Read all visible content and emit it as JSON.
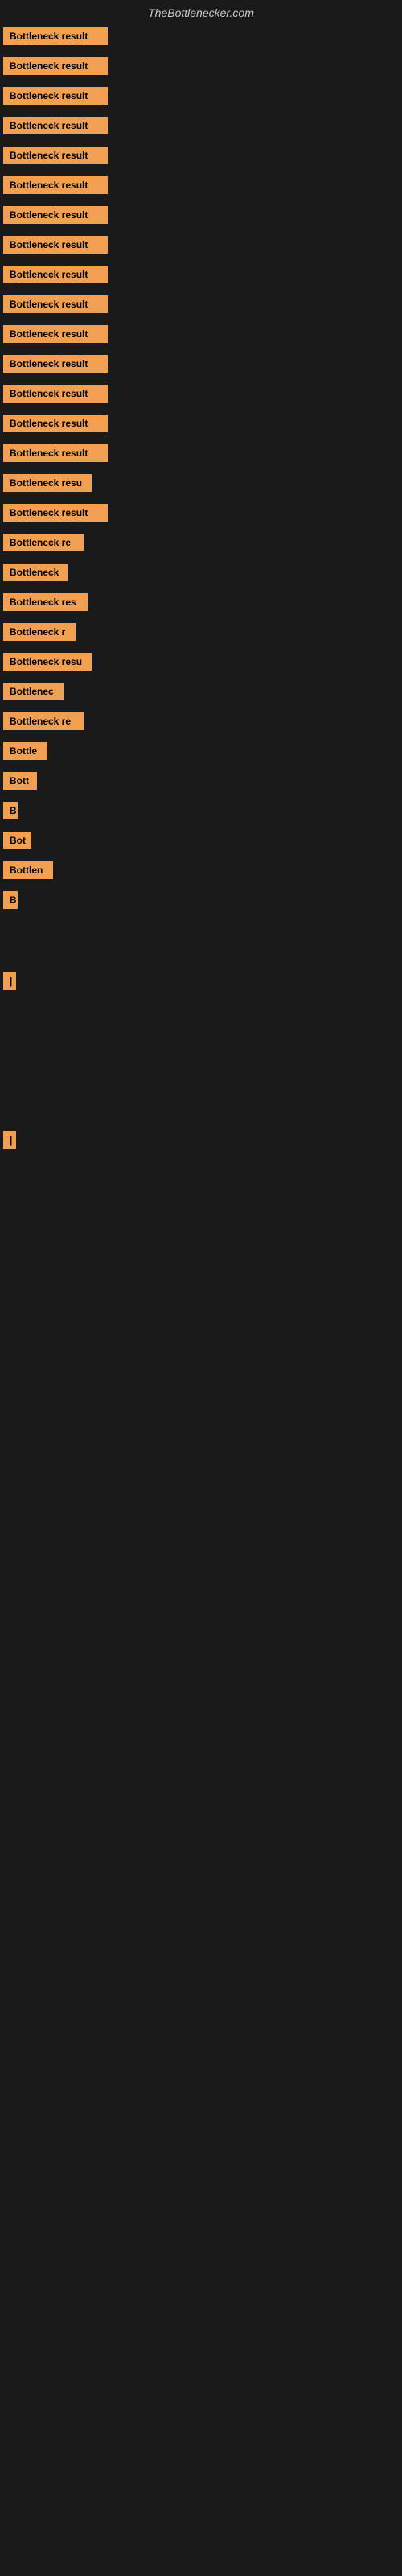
{
  "site": {
    "title": "TheBottlenecker.com"
  },
  "bars": [
    {
      "label": "Bottleneck result",
      "width": 130
    },
    {
      "label": "Bottleneck result",
      "width": 130
    },
    {
      "label": "Bottleneck result",
      "width": 130
    },
    {
      "label": "Bottleneck result",
      "width": 130
    },
    {
      "label": "Bottleneck result",
      "width": 130
    },
    {
      "label": "Bottleneck result",
      "width": 130
    },
    {
      "label": "Bottleneck result",
      "width": 130
    },
    {
      "label": "Bottleneck result",
      "width": 130
    },
    {
      "label": "Bottleneck result",
      "width": 130
    },
    {
      "label": "Bottleneck result",
      "width": 130
    },
    {
      "label": "Bottleneck result",
      "width": 130
    },
    {
      "label": "Bottleneck result",
      "width": 130
    },
    {
      "label": "Bottleneck result",
      "width": 130
    },
    {
      "label": "Bottleneck result",
      "width": 130
    },
    {
      "label": "Bottleneck result",
      "width": 130
    },
    {
      "label": "Bottleneck resu",
      "width": 110
    },
    {
      "label": "Bottleneck result",
      "width": 130
    },
    {
      "label": "Bottleneck re",
      "width": 100
    },
    {
      "label": "Bottleneck",
      "width": 80
    },
    {
      "label": "Bottleneck res",
      "width": 105
    },
    {
      "label": "Bottleneck r",
      "width": 90
    },
    {
      "label": "Bottleneck resu",
      "width": 110
    },
    {
      "label": "Bottlenec",
      "width": 75
    },
    {
      "label": "Bottleneck re",
      "width": 100
    },
    {
      "label": "Bottle",
      "width": 55
    },
    {
      "label": "Bott",
      "width": 42
    },
    {
      "label": "B",
      "width": 18
    },
    {
      "label": "Bot",
      "width": 35
    },
    {
      "label": "Bottlen",
      "width": 62
    },
    {
      "label": "B",
      "width": 18
    },
    {
      "label": "",
      "width": 0
    },
    {
      "label": "",
      "width": 0
    },
    {
      "label": "|",
      "width": 12
    },
    {
      "label": "",
      "width": 0
    },
    {
      "label": "",
      "width": 0
    },
    {
      "label": "",
      "width": 0
    },
    {
      "label": "",
      "width": 0
    },
    {
      "label": "",
      "width": 0
    },
    {
      "label": "|",
      "width": 12
    }
  ]
}
